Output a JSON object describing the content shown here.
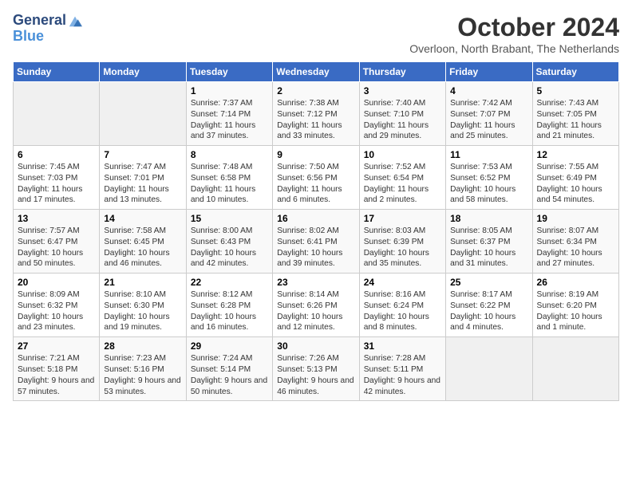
{
  "logo": {
    "line1": "General",
    "line2": "Blue"
  },
  "title": "October 2024",
  "location": "Overloon, North Brabant, The Netherlands",
  "days_of_week": [
    "Sunday",
    "Monday",
    "Tuesday",
    "Wednesday",
    "Thursday",
    "Friday",
    "Saturday"
  ],
  "weeks": [
    [
      {
        "day": "",
        "info": ""
      },
      {
        "day": "",
        "info": ""
      },
      {
        "day": "1",
        "info": "Sunrise: 7:37 AM\nSunset: 7:14 PM\nDaylight: 11 hours and 37 minutes."
      },
      {
        "day": "2",
        "info": "Sunrise: 7:38 AM\nSunset: 7:12 PM\nDaylight: 11 hours and 33 minutes."
      },
      {
        "day": "3",
        "info": "Sunrise: 7:40 AM\nSunset: 7:10 PM\nDaylight: 11 hours and 29 minutes."
      },
      {
        "day": "4",
        "info": "Sunrise: 7:42 AM\nSunset: 7:07 PM\nDaylight: 11 hours and 25 minutes."
      },
      {
        "day": "5",
        "info": "Sunrise: 7:43 AM\nSunset: 7:05 PM\nDaylight: 11 hours and 21 minutes."
      }
    ],
    [
      {
        "day": "6",
        "info": "Sunrise: 7:45 AM\nSunset: 7:03 PM\nDaylight: 11 hours and 17 minutes."
      },
      {
        "day": "7",
        "info": "Sunrise: 7:47 AM\nSunset: 7:01 PM\nDaylight: 11 hours and 13 minutes."
      },
      {
        "day": "8",
        "info": "Sunrise: 7:48 AM\nSunset: 6:58 PM\nDaylight: 11 hours and 10 minutes."
      },
      {
        "day": "9",
        "info": "Sunrise: 7:50 AM\nSunset: 6:56 PM\nDaylight: 11 hours and 6 minutes."
      },
      {
        "day": "10",
        "info": "Sunrise: 7:52 AM\nSunset: 6:54 PM\nDaylight: 11 hours and 2 minutes."
      },
      {
        "day": "11",
        "info": "Sunrise: 7:53 AM\nSunset: 6:52 PM\nDaylight: 10 hours and 58 minutes."
      },
      {
        "day": "12",
        "info": "Sunrise: 7:55 AM\nSunset: 6:49 PM\nDaylight: 10 hours and 54 minutes."
      }
    ],
    [
      {
        "day": "13",
        "info": "Sunrise: 7:57 AM\nSunset: 6:47 PM\nDaylight: 10 hours and 50 minutes."
      },
      {
        "day": "14",
        "info": "Sunrise: 7:58 AM\nSunset: 6:45 PM\nDaylight: 10 hours and 46 minutes."
      },
      {
        "day": "15",
        "info": "Sunrise: 8:00 AM\nSunset: 6:43 PM\nDaylight: 10 hours and 42 minutes."
      },
      {
        "day": "16",
        "info": "Sunrise: 8:02 AM\nSunset: 6:41 PM\nDaylight: 10 hours and 39 minutes."
      },
      {
        "day": "17",
        "info": "Sunrise: 8:03 AM\nSunset: 6:39 PM\nDaylight: 10 hours and 35 minutes."
      },
      {
        "day": "18",
        "info": "Sunrise: 8:05 AM\nSunset: 6:37 PM\nDaylight: 10 hours and 31 minutes."
      },
      {
        "day": "19",
        "info": "Sunrise: 8:07 AM\nSunset: 6:34 PM\nDaylight: 10 hours and 27 minutes."
      }
    ],
    [
      {
        "day": "20",
        "info": "Sunrise: 8:09 AM\nSunset: 6:32 PM\nDaylight: 10 hours and 23 minutes."
      },
      {
        "day": "21",
        "info": "Sunrise: 8:10 AM\nSunset: 6:30 PM\nDaylight: 10 hours and 19 minutes."
      },
      {
        "day": "22",
        "info": "Sunrise: 8:12 AM\nSunset: 6:28 PM\nDaylight: 10 hours and 16 minutes."
      },
      {
        "day": "23",
        "info": "Sunrise: 8:14 AM\nSunset: 6:26 PM\nDaylight: 10 hours and 12 minutes."
      },
      {
        "day": "24",
        "info": "Sunrise: 8:16 AM\nSunset: 6:24 PM\nDaylight: 10 hours and 8 minutes."
      },
      {
        "day": "25",
        "info": "Sunrise: 8:17 AM\nSunset: 6:22 PM\nDaylight: 10 hours and 4 minutes."
      },
      {
        "day": "26",
        "info": "Sunrise: 8:19 AM\nSunset: 6:20 PM\nDaylight: 10 hours and 1 minute."
      }
    ],
    [
      {
        "day": "27",
        "info": "Sunrise: 7:21 AM\nSunset: 5:18 PM\nDaylight: 9 hours and 57 minutes."
      },
      {
        "day": "28",
        "info": "Sunrise: 7:23 AM\nSunset: 5:16 PM\nDaylight: 9 hours and 53 minutes."
      },
      {
        "day": "29",
        "info": "Sunrise: 7:24 AM\nSunset: 5:14 PM\nDaylight: 9 hours and 50 minutes."
      },
      {
        "day": "30",
        "info": "Sunrise: 7:26 AM\nSunset: 5:13 PM\nDaylight: 9 hours and 46 minutes."
      },
      {
        "day": "31",
        "info": "Sunrise: 7:28 AM\nSunset: 5:11 PM\nDaylight: 9 hours and 42 minutes."
      },
      {
        "day": "",
        "info": ""
      },
      {
        "day": "",
        "info": ""
      }
    ]
  ]
}
